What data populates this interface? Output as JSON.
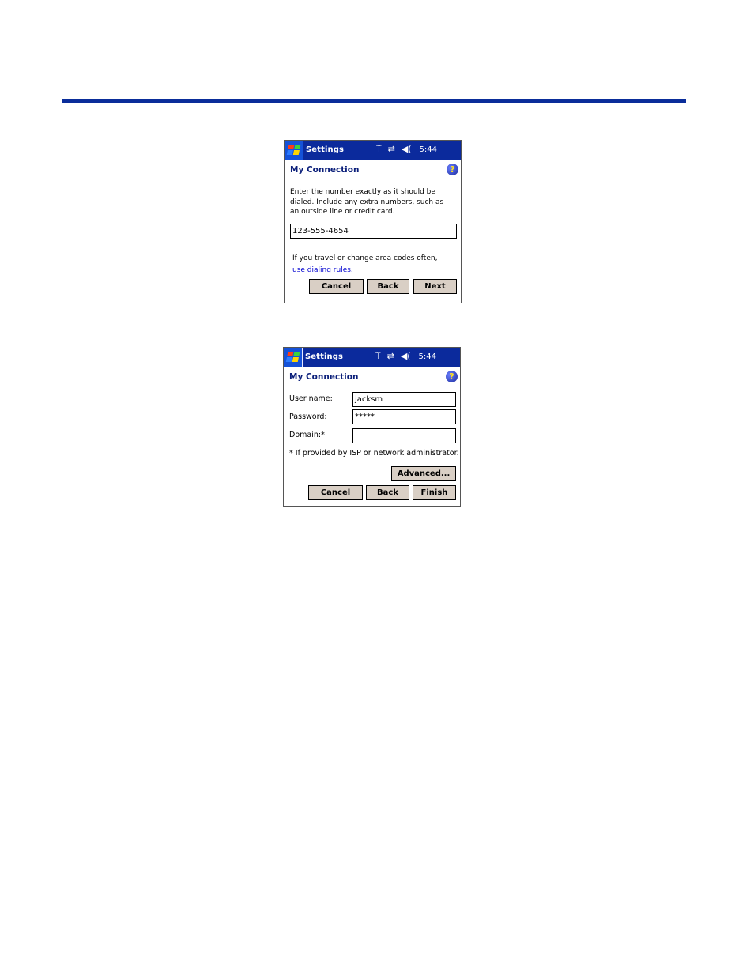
{
  "screens": [
    {
      "titlebar": {
        "app_title": "Settings",
        "clock": "5:44",
        "icons": [
          "signal-antenna-icon",
          "connectivity-arrows-icon",
          "speaker-icon"
        ]
      },
      "page_title": "My Connection",
      "instructions": "Enter the number exactly as it should be dialed.  Include any extra numbers, such as an outside line or credit card.",
      "instructions_lines": [
        "Enter the number exactly as it should be",
        "dialed.  Include any extra numbers, such as",
        "an outside line or credit card."
      ],
      "phone_number": "123-555-4654",
      "travel_hint": "If you travel or change area codes often,",
      "dialing_rules_link": "use dialing rules.",
      "buttons": {
        "cancel": "Cancel",
        "back": "Back",
        "next": "Next"
      }
    },
    {
      "titlebar": {
        "app_title": "Settings",
        "clock": "5:44",
        "icons": [
          "signal-antenna-icon",
          "connectivity-arrows-icon",
          "speaker-icon"
        ]
      },
      "page_title": "My Connection",
      "fields": {
        "username_label": "User name:",
        "username_value": "jacksm",
        "password_label": "Password:",
        "password_value": "*****",
        "domain_label": "Domain:*",
        "domain_value": ""
      },
      "footnote": "* If provided by ISP or network administrator.",
      "buttons": {
        "advanced": "Advanced...",
        "cancel": "Cancel",
        "back": "Back",
        "finish": "Finish"
      }
    }
  ],
  "glyphs": {
    "antenna": "⍡",
    "arrows": "⇄",
    "speaker": "◀(",
    "help": "?"
  },
  "colors": {
    "rule": "#0a2d9a",
    "titlebar": "#0b2a9c",
    "button_face": "#d9cfc5",
    "link": "#0000d0"
  }
}
